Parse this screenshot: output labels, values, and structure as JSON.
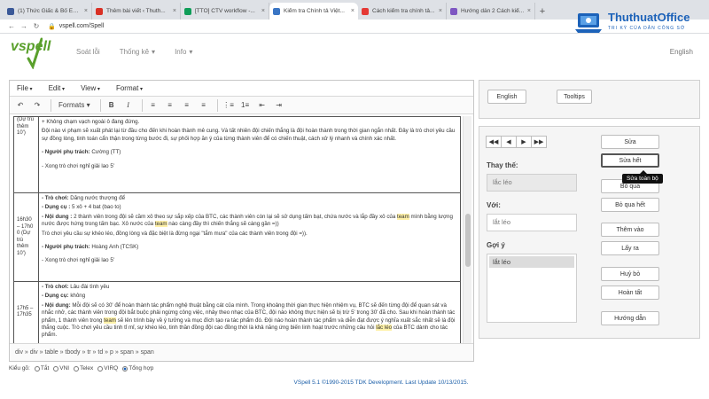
{
  "browser": {
    "tabs": [
      {
        "title": "(1) Thức Giấc & Bố Em...",
        "color": "#3b5998",
        "active": false
      },
      {
        "title": "Thêm bài viết ‹ Thuth...",
        "color": "#d93025",
        "active": false
      },
      {
        "title": "[TTO] CTV workflow -...",
        "color": "#0f9d58",
        "active": false
      },
      {
        "title": "Kiểm tra Chính tả Việt...",
        "color": "#3a75c4",
        "active": true
      },
      {
        "title": "Cách kiểm tra chính tả...",
        "color": "#e53935",
        "active": false
      },
      {
        "title": "Hướng dẫn 2 Cách kiể...",
        "color": "#7e57c2",
        "active": false
      }
    ],
    "url": "vspell.com/Spell",
    "new_tab": "+"
  },
  "watermark": {
    "name": "ThuthuatOffice",
    "tagline": "TRI KỲ CỦA DÂN CÔNG SỞ"
  },
  "site": {
    "logo": "vspell",
    "nav": [
      {
        "label": "Soát lỗi"
      },
      {
        "label": "Thống kê"
      },
      {
        "label": "Info"
      }
    ],
    "lang": "English"
  },
  "editor": {
    "menus": [
      "File",
      "Edit",
      "View",
      "Format"
    ],
    "formats_label": "Formats",
    "rows": [
      {
        "time": "(Dự trù thêm 10')",
        "lines": [
          {
            "text": "+ Không chạm vạch ngoài ô đang đứng.",
            "bold": ""
          },
          {
            "text": "Đội nào vi phạm sẽ xuất phát lại từ đầu cho đến khi hoàn thành mê cung. Và tất nhiên đội chiến thắng là đội hoàn thành trong thời gian ngắn nhất. Đây là trò chơi yêu cầu sự đồng lòng, tinh toán cẩn thận trong từng bước đi, sự phối hợp ăn ý của từng thành viên để có chiến thuật, cách xử lý nhanh và chính xác nhất.",
            "bold": ""
          },
          {
            "text": " Cường (TT)",
            "bold": "-  Người phụ trách:"
          },
          {
            "text": "- Xong trò chơi nghỉ giải lao 5'",
            "bold": ""
          }
        ]
      },
      {
        "time": "16h30 – 17h0 0 (Dự trù thêm 10')",
        "lines": [
          {
            "text": " Dăng nước thượng để",
            "bold": "-  Trò chơi:"
          },
          {
            "text": " 5 xô + 4 bat (bao to)",
            "bold": "-  Dụng cụ :"
          },
          {
            "text": " 2 thành viên trong đội sẽ cầm xô theo sự sắp xếp của BTC, các thành viên còn lại sẽ sử dụng tấm bạt, chứa nước và lắp đầy xô của team mình bằng lượng nước được hứng trong tấm bạc. Xô nước của team nào càng đầy thì chiến thắng sẽ càng gần =))",
            "bold": "-  Nội dung :"
          },
          {
            "text": "Trò chơi yêu cầu sự khéo léo, đồng lòng và đặc biệt là đừng ngại \"tắm mưa\" của các thành viên trong đội =)).",
            "bold": ""
          },
          {
            "text": " Hoàng Anh (TCSK)",
            "bold": "-  Người phụ trách:"
          },
          {
            "text": "- Xong trò chơi nghỉ giải lao 5'",
            "bold": ""
          }
        ]
      },
      {
        "time": "17h5 – 17h35",
        "lines": [
          {
            "text": " Lâu đài tình yêu",
            "bold": "-  Trò chơi:"
          },
          {
            "text": " không",
            "bold": "-  Dụng cụ:"
          },
          {
            "text": " Mỗi đội sẽ có 30' để hoàn thành tác phẩm nghệ thuật bằng cát của mình. Trong khoảng thời gian thực hiện nhiệm vụ, BTC sẽ đến từng đội để quan sát và nhắc nhở, các thành viên trong đội bắt buộc phải ngừng công việc, nhảy theo nhạc của BTC, đội nào không thực hiện sẽ bị trừ 5' trong 30' đã cho. Sau khi hoàn thành tác phẩm, 1 thành viên trong team sẽ lên trình bày về ý tưởng và mục đích tạo ra tác phẩm đó. Đội nào hoàn thành tác phẩm và diễn đạt được ý nghĩa xuất sắc nhất sẽ là đội thắng cuộc. Trò chơi yêu cầu tinh tỉ mỉ, sự khéo léo, tinh thần đồng đội cao đồng thời là khả năng ứng biến linh hoạt trước những câu hỏi lắc léo của BTC dành cho tác phẩm.",
            "bold": "-  Nội dung:"
          }
        ]
      }
    ],
    "path": "div » div » table » tbody » tr » td » p » span » span"
  },
  "kieugo": {
    "label": "Kiểu gõ:",
    "options": [
      {
        "label": "Tắt",
        "on": false
      },
      {
        "label": "VNI",
        "on": false
      },
      {
        "label": "Telex",
        "on": false
      },
      {
        "label": "VIRQ",
        "on": false
      },
      {
        "label": "Tổng hợp",
        "on": true
      }
    ]
  },
  "footer": "VSpell 5.1 ©1990-2015 TDK Development. Last Update 10/13/2015.",
  "right": {
    "english_btn": "English",
    "tooltips_btn": "Tooltips",
    "nav_icons": [
      "first",
      "prev",
      "next",
      "last"
    ],
    "thay_the_label": "Thay thế:",
    "thay_the_value": "lắc léo",
    "voi_label": "Với:",
    "voi_value": "lắt léo",
    "goiy_label": "Gợi ý",
    "suggestion": "lắt léo",
    "actions": [
      "Sửa",
      "Sửa hết",
      "Bỏ qua",
      "Bỏ qua hết",
      "Thêm vào",
      "Lấy ra",
      "Huỷ bỏ",
      "Hoàn tất",
      "Hướng dẫn"
    ],
    "tooltip": "Sửa toàn bộ"
  }
}
